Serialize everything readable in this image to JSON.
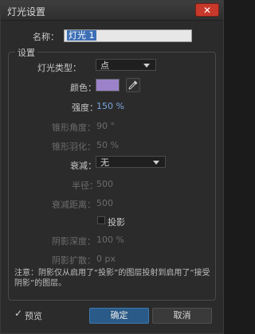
{
  "window": {
    "title": "灯光设置",
    "close": "✕"
  },
  "name_field": {
    "label": "名称：",
    "value": "灯光 1"
  },
  "group": {
    "legend": "设置"
  },
  "light_type": {
    "label": "灯光类型：",
    "value": "点"
  },
  "color": {
    "label": "颜色：",
    "hex": "#9c82c9"
  },
  "intensity": {
    "label": "强度：",
    "value": "150 %"
  },
  "cone_angle": {
    "label": "锥形角度：",
    "value": "90 °"
  },
  "cone_feather": {
    "label": "锥形羽化：",
    "value": "50 %"
  },
  "falloff": {
    "label": "衰减：",
    "value": "无"
  },
  "radius": {
    "label": "半径：",
    "value": "500"
  },
  "falloff_distance": {
    "label": "衰减距离：",
    "value": "500"
  },
  "cast_shadows": {
    "label": "投影",
    "checked": false
  },
  "shadow_darkness": {
    "label": "阴影深度：",
    "value": "100 %"
  },
  "shadow_diffusion": {
    "label": "阴影扩散：",
    "value": "0 px"
  },
  "note": {
    "text": "注意：阴影仅从启用了“投影”的图层投射到启用了“接受阴影”的图层。"
  },
  "footer": {
    "preview_label": "预览",
    "preview_checked": true,
    "ok_label": "确定",
    "cancel_label": "取消"
  }
}
